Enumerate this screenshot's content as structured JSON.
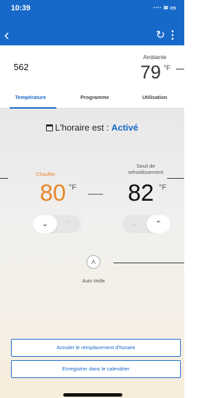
{
  "status_bar": {
    "time": "10:39",
    "indicators": "···· ≋ ▭"
  },
  "nav": {
    "back_icon": "‹",
    "refresh_icon": "↻",
    "more_icon": "⋮"
  },
  "device": {
    "name": "562",
    "ambient_label": "Ambiante",
    "ambient_value": "79",
    "ambient_unit": "°F"
  },
  "tabs": [
    {
      "label": "Température",
      "active": true
    },
    {
      "label": "Programme",
      "active": false
    },
    {
      "label": "Utilisation",
      "active": false
    }
  ],
  "schedule": {
    "prefix": "L'horaire est : ",
    "value": "Activé"
  },
  "heat": {
    "label": "Chauffer",
    "value": "80",
    "unit": "°F",
    "down_label": "⌄",
    "up_label": "⌃"
  },
  "cool": {
    "label": "Seuil de refroidissement",
    "value": "82",
    "unit": "°F",
    "down_label": "⌄",
    "up_label": "⌃"
  },
  "mode": {
    "icon_letter": "A",
    "label": "Auto Veille"
  },
  "buttons": {
    "cancel_override": "Annuler le remplacement d'horaire",
    "save_calendar": "Enregistrer dans le calendrier"
  },
  "colors": {
    "primary": "#1769c9",
    "heat": "#e8872c"
  }
}
